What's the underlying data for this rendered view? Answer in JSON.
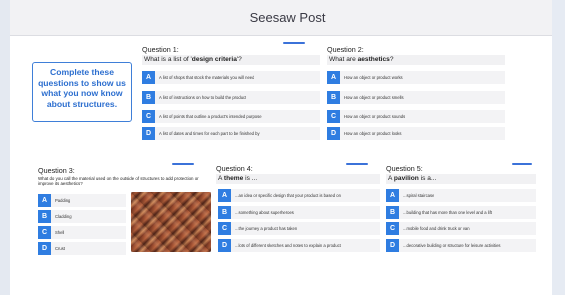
{
  "app": {
    "title": "Seesaw Post"
  },
  "intro_text": "Complete these questions to show us what you now know about structures.",
  "questions": [
    {
      "heading": "Question 1:",
      "prompt_pre": "What is a list of '",
      "prompt_bold": "design criteria",
      "prompt_post": "'?",
      "options": [
        {
          "letter": "A",
          "text": "A list of shops that stock the materials you will need"
        },
        {
          "letter": "B",
          "text": "A list of instructions on how to build the product"
        },
        {
          "letter": "C",
          "text": "A list of points that outline a product's intended purpose"
        },
        {
          "letter": "D",
          "text": "A list of dates and times for each part to be finished by"
        }
      ]
    },
    {
      "heading": "Question 2:",
      "prompt_pre": "What are ",
      "prompt_bold": "aesthetics",
      "prompt_post": "?",
      "options": [
        {
          "letter": "A",
          "text": "How an object or product works"
        },
        {
          "letter": "B",
          "text": "How an object or product smells"
        },
        {
          "letter": "C",
          "text": "How an object or product sounds"
        },
        {
          "letter": "D",
          "text": "How an object or product looks"
        }
      ]
    },
    {
      "heading": "Question 3:",
      "prompt_pre": "What do you call the material used on the outside of structures to add protection or improve its aesthetics?",
      "prompt_bold": "",
      "prompt_post": "",
      "options": [
        {
          "letter": "A",
          "text": "Padding"
        },
        {
          "letter": "B",
          "text": "Cladding"
        },
        {
          "letter": "C",
          "text": "Shell"
        },
        {
          "letter": "D",
          "text": "Crust"
        }
      ]
    },
    {
      "heading": "Question 4:",
      "prompt_pre": "A ",
      "prompt_bold": "theme",
      "prompt_post": " is ...",
      "options": [
        {
          "letter": "A",
          "text": "...an idea or specific design that your product is based on"
        },
        {
          "letter": "B",
          "text": "...something about superheroes"
        },
        {
          "letter": "C",
          "text": "...the journey a product has taken"
        },
        {
          "letter": "D",
          "text": "...lots of different sketches and notes to explain a product"
        }
      ]
    },
    {
      "heading": "Question 5:",
      "prompt_pre": "A ",
      "prompt_bold": "pavilion",
      "prompt_post": " is a...",
      "options": [
        {
          "letter": "A",
          "text": "...spiral staircase"
        },
        {
          "letter": "B",
          "text": "...building that has more than one level and a lift"
        },
        {
          "letter": "C",
          "text": "...mobile food and drink truck or van"
        },
        {
          "letter": "D",
          "text": "...decorative building or structure for leisure activities"
        }
      ]
    }
  ]
}
